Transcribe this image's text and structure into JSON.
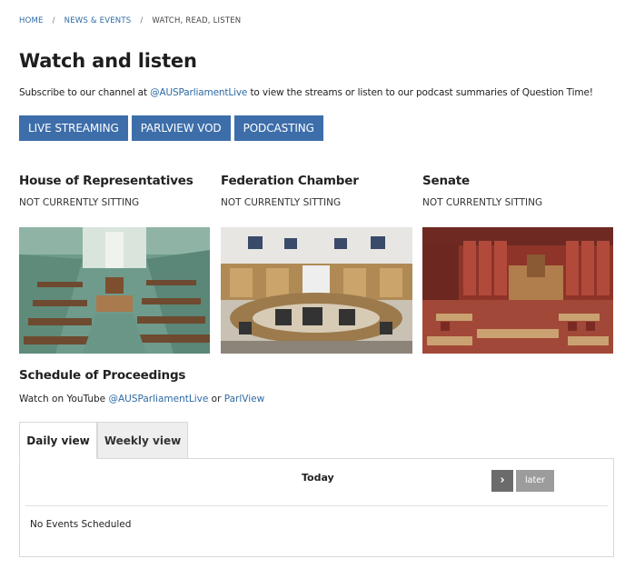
{
  "breadcrumb": {
    "home": "HOME",
    "news": "NEWS & EVENTS",
    "current": "WATCH, READ, LISTEN"
  },
  "page": {
    "title": "Watch and listen",
    "intro_before": "Subscribe to our channel at ",
    "intro_link": "@AUSParliamentLive",
    "intro_after": " to view the streams or listen to our podcast summaries of Question Time!"
  },
  "buttons": {
    "live": "LIVE STREAMING",
    "parlview": "PARLVIEW VOD",
    "podcasting": "PODCASTING"
  },
  "chambers": [
    {
      "name": "House of Representatives",
      "status": "NOT CURRENTLY SITTING",
      "photo": "house-of-representatives-chamber-photo"
    },
    {
      "name": "Federation Chamber",
      "status": "NOT CURRENTLY SITTING",
      "photo": "federation-chamber-photo"
    },
    {
      "name": "Senate",
      "status": "NOT CURRENTLY SITTING",
      "photo": "senate-chamber-photo"
    }
  ],
  "schedule": {
    "title": "Schedule of Proceedings",
    "watch_prefix": "Watch on YouTube ",
    "youtube_link": "@AUSParliamentLive",
    "or": " or ",
    "parlview_link": "ParlView",
    "tabs": {
      "daily": "Daily view",
      "weekly": "Weekly view"
    },
    "active_tab": "daily",
    "today_label": "Today",
    "next_icon": "›",
    "later_label": "later",
    "empty_message": "No Events Scheduled"
  },
  "colors": {
    "link": "#2f6aa4",
    "button_bg": "#3d6eaa",
    "house_green": "#5c8c7c",
    "senate_red": "#9c3a2c"
  }
}
